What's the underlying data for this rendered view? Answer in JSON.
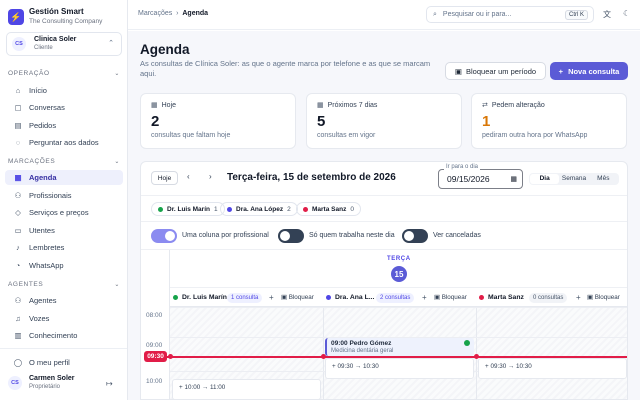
{
  "brand": {
    "title": "Gestión Smart",
    "subtitle": "The Consulting Company",
    "logo_icon": "lightning-logo"
  },
  "client": {
    "initials": "CS",
    "name": "Clinica Soler",
    "role": "Cliente"
  },
  "sidebar": {
    "sections": [
      {
        "label": "OPERAÇÃO",
        "items": [
          {
            "label": "Início",
            "icon": "home-icon"
          },
          {
            "label": "Conversas",
            "icon": "chat-icon"
          },
          {
            "label": "Pedidos",
            "icon": "document-icon"
          },
          {
            "label": "Perguntar aos dados",
            "icon": "chat-bubble-icon"
          }
        ]
      },
      {
        "label": "MARCAÇÕES",
        "items": [
          {
            "label": "Agenda",
            "icon": "calendar-icon",
            "active": true
          },
          {
            "label": "Profissionais",
            "icon": "users-icon"
          },
          {
            "label": "Serviços e preços",
            "icon": "tag-icon"
          },
          {
            "label": "Utentes",
            "icon": "contact-card-icon"
          },
          {
            "label": "Lembretes",
            "icon": "bell-icon"
          },
          {
            "label": "WhatsApp",
            "icon": "whatsapp-icon"
          }
        ]
      },
      {
        "label": "AGENTES",
        "items": [
          {
            "label": "Agentes",
            "icon": "agents-icon"
          },
          {
            "label": "Vozes",
            "icon": "voice-icon"
          },
          {
            "label": "Conhecimento",
            "icon": "book-icon"
          }
        ]
      }
    ],
    "profile_link": "O meu perfil",
    "user": {
      "initials": "CS",
      "name": "Carmen Soler",
      "role": "Proprietário"
    }
  },
  "topbar": {
    "breadcrumb": [
      "Marcações",
      "Agenda"
    ],
    "search_placeholder": "Pesquisar ou ir para...",
    "shortcut": "Ctrl K"
  },
  "page": {
    "title": "Agenda",
    "description": "As consultas de Clínica Soler: as que o agente marca por telefone e as que se marcam aqui.",
    "block_button": "Bloquear um período",
    "new_button": "Nova consulta"
  },
  "stats": [
    {
      "label": "Hoje",
      "value": "2",
      "sub": "consultas que faltam hoje",
      "color": "#111827"
    },
    {
      "label": "Próximos 7 dias",
      "value": "5",
      "sub": "consultas em vigor",
      "color": "#111827"
    },
    {
      "label": "Pedem alteração",
      "value": "1",
      "sub": "pediram outra hora por WhatsApp",
      "color": "#d97706"
    }
  ],
  "calendar": {
    "today_button": "Hoje",
    "date_title": "Terça-feira, 15 de setembro de 2026",
    "goto_label": "Ir para o dia",
    "goto_value": "09/15/2026",
    "views": [
      "Dia",
      "Semana",
      "Mês"
    ],
    "active_view": "Dia",
    "professionals": [
      {
        "name": "Dr. Luis Marín",
        "count": "1",
        "color": "#16a34a"
      },
      {
        "name": "Dra. Ana López",
        "count": "2",
        "color": "#4f46e5"
      },
      {
        "name": "Marta Sanz",
        "count": "0",
        "color": "#e11d48"
      }
    ],
    "toggles": [
      {
        "label": "Uma coluna por profissional",
        "on": true
      },
      {
        "label": "Só quem trabalha neste dia",
        "on": false
      },
      {
        "label": "Ver canceladas",
        "on": false
      }
    ],
    "day_label": "TERÇA",
    "day_number": "15",
    "columns": [
      {
        "name": "Dr. Luis Marín",
        "count": "1 consulta",
        "color": "#16a34a"
      },
      {
        "name": "Dra. Ana L...",
        "count": "2 consultas",
        "color": "#4f46e5"
      },
      {
        "name": "Marta Sanz",
        "count": "0 consultas",
        "color": "#e11d48"
      }
    ],
    "block_label": "Bloquear",
    "times": [
      "08:00",
      "09:00",
      "10:00"
    ],
    "now": "09:30",
    "appointment": {
      "time": "09:00",
      "patient": "Pedro Gómez",
      "service": "Medicina dentária geral"
    },
    "slots": [
      "09:30 → 10:30",
      "09:30 → 10:30",
      "10:00 → 11:00"
    ]
  }
}
